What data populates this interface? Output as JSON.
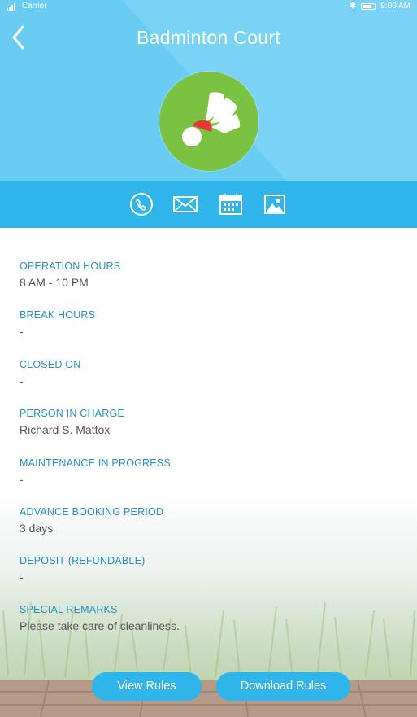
{
  "status_bar": {
    "carrier": "Carrier",
    "time": "9:00 AM"
  },
  "header": {
    "title": "Badminton Court"
  },
  "actions": [
    {
      "name": "phone-icon"
    },
    {
      "name": "mail-icon"
    },
    {
      "name": "calendar-icon"
    },
    {
      "name": "gallery-icon"
    }
  ],
  "details": [
    {
      "label": "OPERATION HOURS",
      "value": "8 AM - 10 PM"
    },
    {
      "label": "BREAK HOURS",
      "value": "-"
    },
    {
      "label": "CLOSED ON",
      "value": "-"
    },
    {
      "label": "PERSON IN CHARGE",
      "value": "Richard S. Mattox"
    },
    {
      "label": "MAINTENANCE IN PROGRESS",
      "value": "-"
    },
    {
      "label": "ADVANCE BOOKING PERIOD",
      "value": "3 days"
    },
    {
      "label": "DEPOSIT (REFUNDABLE)",
      "value": "-"
    },
    {
      "label": "SPECIAL REMARKS",
      "value": "Please take care of cleanliness."
    }
  ],
  "buttons": {
    "view_rules": "View Rules",
    "download_rules": "Download Rules"
  },
  "colors": {
    "header_light": "#7ad3f5",
    "accent": "#2fb5ea",
    "label": "#2590be",
    "avatar_green": "#7cc242"
  }
}
